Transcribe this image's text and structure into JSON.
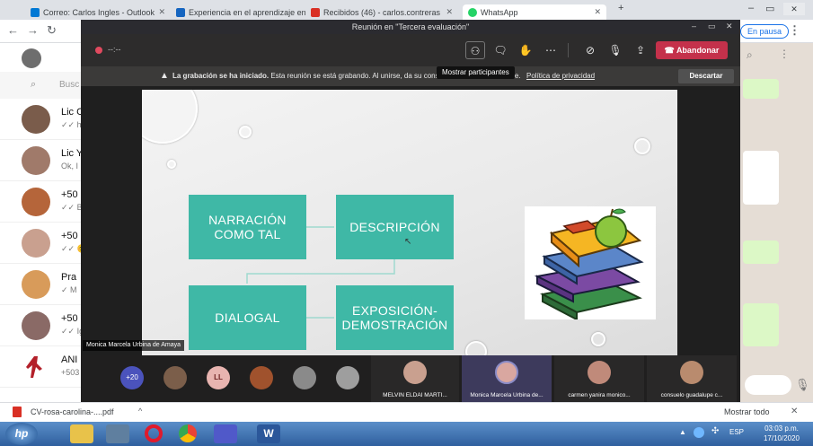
{
  "browser": {
    "tabs": [
      {
        "label": "Correo: Carlos Ingles - Outlook",
        "color": "#0078d4"
      },
      {
        "label": "Experiencia en el aprendizaje en",
        "color": "#1565c0"
      },
      {
        "label": "Recibidos (46) - carlos.contreras",
        "color": "#d93025"
      },
      {
        "label": "WhatsApp",
        "color": "#25d366"
      }
    ],
    "new_tab": "+",
    "paused_label": "En pausa"
  },
  "whatsapp": {
    "search_placeholder": "Busc",
    "chats": [
      {
        "name": "Lic C",
        "preview": "✓✓ h",
        "color": "#7a5c4b"
      },
      {
        "name": "Lic Y",
        "preview": "Ok, I",
        "color": "#a07a6a"
      },
      {
        "name": "+50",
        "preview": "✓✓ B",
        "color": "#b5653a"
      },
      {
        "name": "+50",
        "preview": "✓✓ 😊",
        "color": "#c9a08f"
      },
      {
        "name": "Pra",
        "preview": "✓ M",
        "color": "#d89b5a"
      },
      {
        "name": "+50",
        "preview": "✓✓ Ig",
        "color": "#8a6a66"
      },
      {
        "name": "ANI",
        "preview": "+503",
        "color": "#b3202a"
      }
    ]
  },
  "teams": {
    "title": "Reunión en \"Tercera evaluación\"",
    "timer": "--:--",
    "leave_label": "Abandonar",
    "tooltip": "Mostrar participantes",
    "recording_bold": "La grabación se ha iniciado.",
    "recording_text": "Esta reunión se está grabando. Al unirse, da su conse",
    "recording_tail": "abe.",
    "privacy_link": "Política de privacidad",
    "dismiss_label": "Descartar",
    "presenter_label": "Monica Marcela Urbina de Amaya",
    "more_count": "+20",
    "avatars": [
      {
        "initials": "",
        "color": "#7b5e4a"
      },
      {
        "initials": "LL",
        "color": "#e8b4b0"
      },
      {
        "initials": "",
        "color": "#a0522d"
      },
      {
        "initials": "",
        "color": "#8a8a8a"
      },
      {
        "initials": "",
        "color": "#9e9e9e"
      }
    ],
    "tiles": [
      {
        "name": "MELVIN ELDAI MARTI...",
        "color": "#c9a08f"
      },
      {
        "name": "Monica Marcela Urbina de...",
        "color": "#d9a7a0"
      },
      {
        "name": "carmen yanira monico...",
        "color": "#c08a7a"
      },
      {
        "name": "consuelo guadalupe c...",
        "color": "#b98b6e"
      }
    ]
  },
  "slide": {
    "boxes": [
      {
        "label": "NARRACIÓN\nCOMO TAL"
      },
      {
        "label": "DESCRIPCIÓN"
      },
      {
        "label": "DIALOGAL"
      },
      {
        "label": "EXPOSICIÓN-\nDEMOSTRACIÓN"
      }
    ]
  },
  "downloads": {
    "file": "CV-rosa-carolina-....pdf",
    "show_all": "Mostrar todo"
  },
  "taskbar": {
    "lang": "ESP",
    "time": "03:03 p.m.",
    "date": "17/10/2020"
  }
}
